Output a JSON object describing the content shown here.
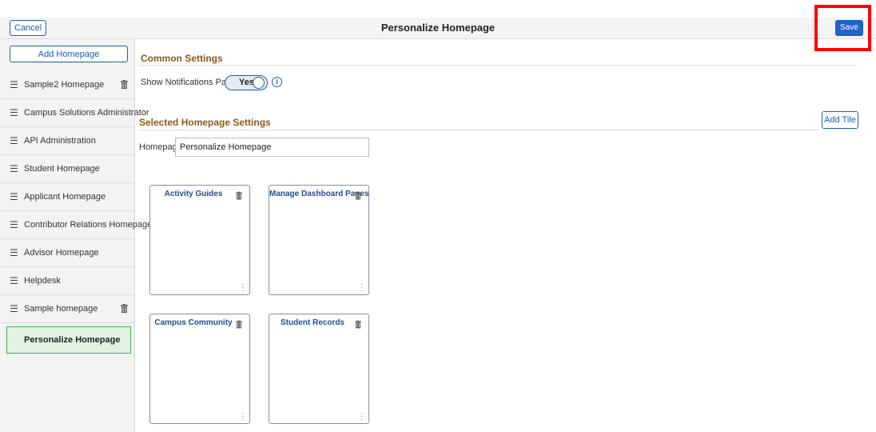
{
  "header": {
    "cancel_label": "Cancel",
    "title": "Personalize Homepage",
    "save_label": "Save"
  },
  "sidebar": {
    "add_homepage_label": "Add Homepage",
    "items": [
      {
        "label": "Sample2 Homepage",
        "deletable": true
      },
      {
        "label": "Campus Solutions Administrator",
        "deletable": false
      },
      {
        "label": "API Administration",
        "deletable": false
      },
      {
        "label": "Student Homepage",
        "deletable": false
      },
      {
        "label": "Applicant Homepage",
        "deletable": false
      },
      {
        "label": "Contributor Relations Homepage",
        "deletable": false
      },
      {
        "label": "Advisor Homepage",
        "deletable": false
      },
      {
        "label": "Helpdesk",
        "deletable": false
      },
      {
        "label": "Sample homepage",
        "deletable": true
      },
      {
        "label": "Personalize Homepage",
        "deletable": false,
        "active": true
      }
    ]
  },
  "common_settings": {
    "title": "Common Settings",
    "notifications_label": "Show Notifications Panel",
    "notifications_toggle": "Yes"
  },
  "selected_settings": {
    "title": "Selected Homepage Settings",
    "add_tile_label": "Add Tile",
    "homepage_label": "Homepage",
    "homepage_value": "Personalize Homepage"
  },
  "tiles": [
    {
      "title": "Activity Guides"
    },
    {
      "title": "Manage Dashboard Pages"
    },
    {
      "title": "Campus Community"
    },
    {
      "title": "Student Records"
    }
  ],
  "colors": {
    "accent": "#1f63c6",
    "section_title": "#8a5a1a",
    "active_item": "#e2f2e2",
    "highlight": "#ff0000"
  }
}
